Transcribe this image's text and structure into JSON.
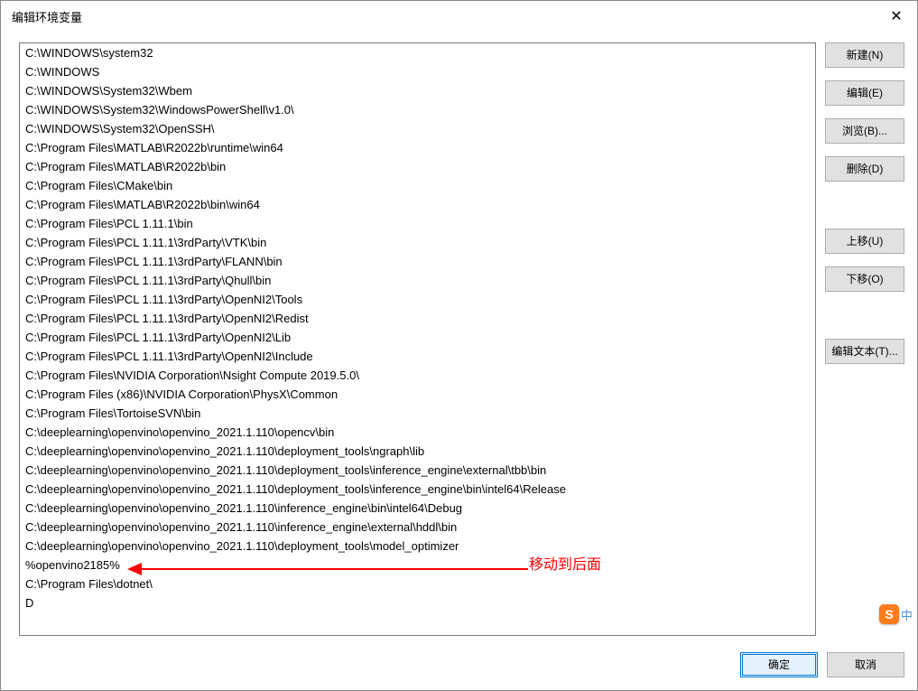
{
  "window": {
    "title": "编辑环境变量",
    "close_glyph": "✕"
  },
  "list": {
    "items": [
      "C:\\WINDOWS\\system32",
      "C:\\WINDOWS",
      "C:\\WINDOWS\\System32\\Wbem",
      "C:\\WINDOWS\\System32\\WindowsPowerShell\\v1.0\\",
      "C:\\WINDOWS\\System32\\OpenSSH\\",
      "C:\\Program Files\\MATLAB\\R2022b\\runtime\\win64",
      "C:\\Program Files\\MATLAB\\R2022b\\bin",
      "C:\\Program Files\\CMake\\bin",
      "C:\\Program Files\\MATLAB\\R2022b\\bin\\win64",
      "C:\\Program Files\\PCL 1.11.1\\bin",
      "C:\\Program Files\\PCL 1.11.1\\3rdParty\\VTK\\bin",
      "C:\\Program Files\\PCL 1.11.1\\3rdParty\\FLANN\\bin",
      "C:\\Program Files\\PCL 1.11.1\\3rdParty\\Qhull\\bin",
      "C:\\Program Files\\PCL 1.11.1\\3rdParty\\OpenNI2\\Tools",
      "C:\\Program Files\\PCL 1.11.1\\3rdParty\\OpenNI2\\Redist",
      "C:\\Program Files\\PCL 1.11.1\\3rdParty\\OpenNI2\\Lib",
      "C:\\Program Files\\PCL 1.11.1\\3rdParty\\OpenNI2\\Include",
      "C:\\Program Files\\NVIDIA Corporation\\Nsight Compute 2019.5.0\\",
      "C:\\Program Files (x86)\\NVIDIA Corporation\\PhysX\\Common",
      "C:\\Program Files\\TortoiseSVN\\bin",
      "C:\\deeplearning\\openvino\\openvino_2021.1.110\\opencv\\bin",
      "C:\\deeplearning\\openvino\\openvino_2021.1.110\\deployment_tools\\ngraph\\lib",
      "C:\\deeplearning\\openvino\\openvino_2021.1.110\\deployment_tools\\inference_engine\\external\\tbb\\bin",
      "C:\\deeplearning\\openvino\\openvino_2021.1.110\\deployment_tools\\inference_engine\\bin\\intel64\\Release",
      "C:\\deeplearning\\openvino\\openvino_2021.1.110\\inference_engine\\bin\\intel64\\Debug",
      "C:\\deeplearning\\openvino\\openvino_2021.1.110\\inference_engine\\external\\hddl\\bin",
      "C:\\deeplearning\\openvino\\openvino_2021.1.110\\deployment_tools\\model_optimizer",
      "%openvino2185%",
      "C:\\Program Files\\dotnet\\",
      "D"
    ]
  },
  "buttons": {
    "new": "新建(N)",
    "edit": "编辑(E)",
    "browse": "浏览(B)...",
    "delete": "删除(D)",
    "move_up": "上移(U)",
    "move_down": "下移(O)",
    "edit_text": "编辑文本(T)...",
    "ok": "确定",
    "cancel": "取消"
  },
  "annotation": {
    "label": "移动到后面"
  },
  "ime": {
    "badge": "S",
    "mode": "中"
  }
}
